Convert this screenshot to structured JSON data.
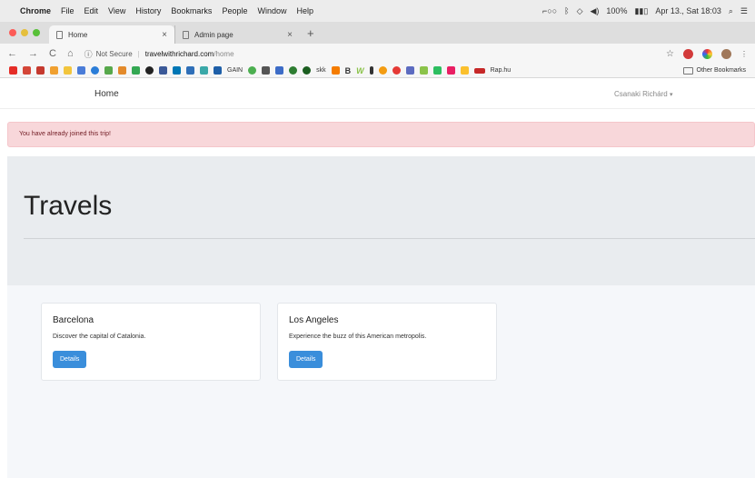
{
  "menubar": {
    "app": "Chrome",
    "items": [
      "File",
      "Edit",
      "View",
      "History",
      "Bookmarks",
      "People",
      "Window",
      "Help"
    ],
    "battery": "100%",
    "datetime": "Apr 13., Sat 18:03"
  },
  "tabs": [
    {
      "label": "Home"
    },
    {
      "label": "Admin page"
    }
  ],
  "address": {
    "security": "Not Secure",
    "host": "travelwithrichard.com",
    "path": "/home"
  },
  "bookmarks": {
    "labels": [
      "GAIN",
      "skk",
      "B",
      "W",
      "Rap.hu"
    ],
    "other": "Other Bookmarks"
  },
  "navbar": {
    "brand": "Home",
    "user": "Csanaki Richárd"
  },
  "alert": {
    "message": "You have already joined this trip!"
  },
  "jumbotron": {
    "title": "Travels"
  },
  "trips": [
    {
      "title": "Barcelona",
      "description": "Discover the capital of Catalonia.",
      "button": "Details"
    },
    {
      "title": "Los Angeles",
      "description": "Experience the buzz of this American metropolis.",
      "button": "Details"
    }
  ]
}
